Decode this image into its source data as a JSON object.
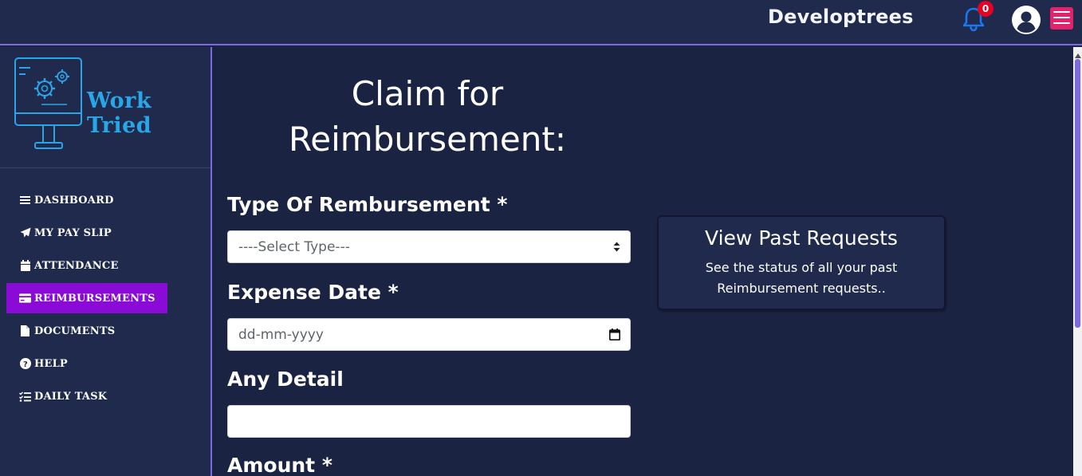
{
  "header": {
    "brand": "Developtrees",
    "notification_count": "0",
    "bell_icon": "bell-icon",
    "user_icon": "user-circle-icon",
    "menu_icon": "hamburger-icon",
    "accent_color": "#7c6ae0",
    "badge_color": "#e60023",
    "menu_button_color": "#e1226d"
  },
  "sidebar": {
    "logo_text": "Work Tried",
    "items": [
      {
        "label": "DASHBOARD",
        "icon": "bars-icon",
        "active": false
      },
      {
        "label": "MY PAY SLIP",
        "icon": "paper-plane-icon",
        "active": false
      },
      {
        "label": "ATTENDANCE",
        "icon": "calendar-icon",
        "active": false
      },
      {
        "label": "REIMBURSEMENTS",
        "icon": "credit-card-icon",
        "active": true
      },
      {
        "label": "DOCUMENTS",
        "icon": "file-icon",
        "active": false
      },
      {
        "label": "HELP",
        "icon": "question-circle-icon",
        "active": false
      },
      {
        "label": "DAILY TASK",
        "icon": "tasks-icon",
        "active": false
      }
    ],
    "active_color": "#8a0ad6"
  },
  "main": {
    "title": "Claim for Reimbursement:",
    "form": {
      "type_label": "Type Of Rembursement *",
      "type_value": "----Select Type---",
      "date_label": "Expense Date *",
      "date_placeholder": "dd-mm-yyyy",
      "detail_label": "Any Detail",
      "detail_value": "",
      "amount_label": "Amount *"
    },
    "past_requests": {
      "title": "View Past Requests",
      "description": "See the status of all your past Reimbursement requests.."
    }
  }
}
